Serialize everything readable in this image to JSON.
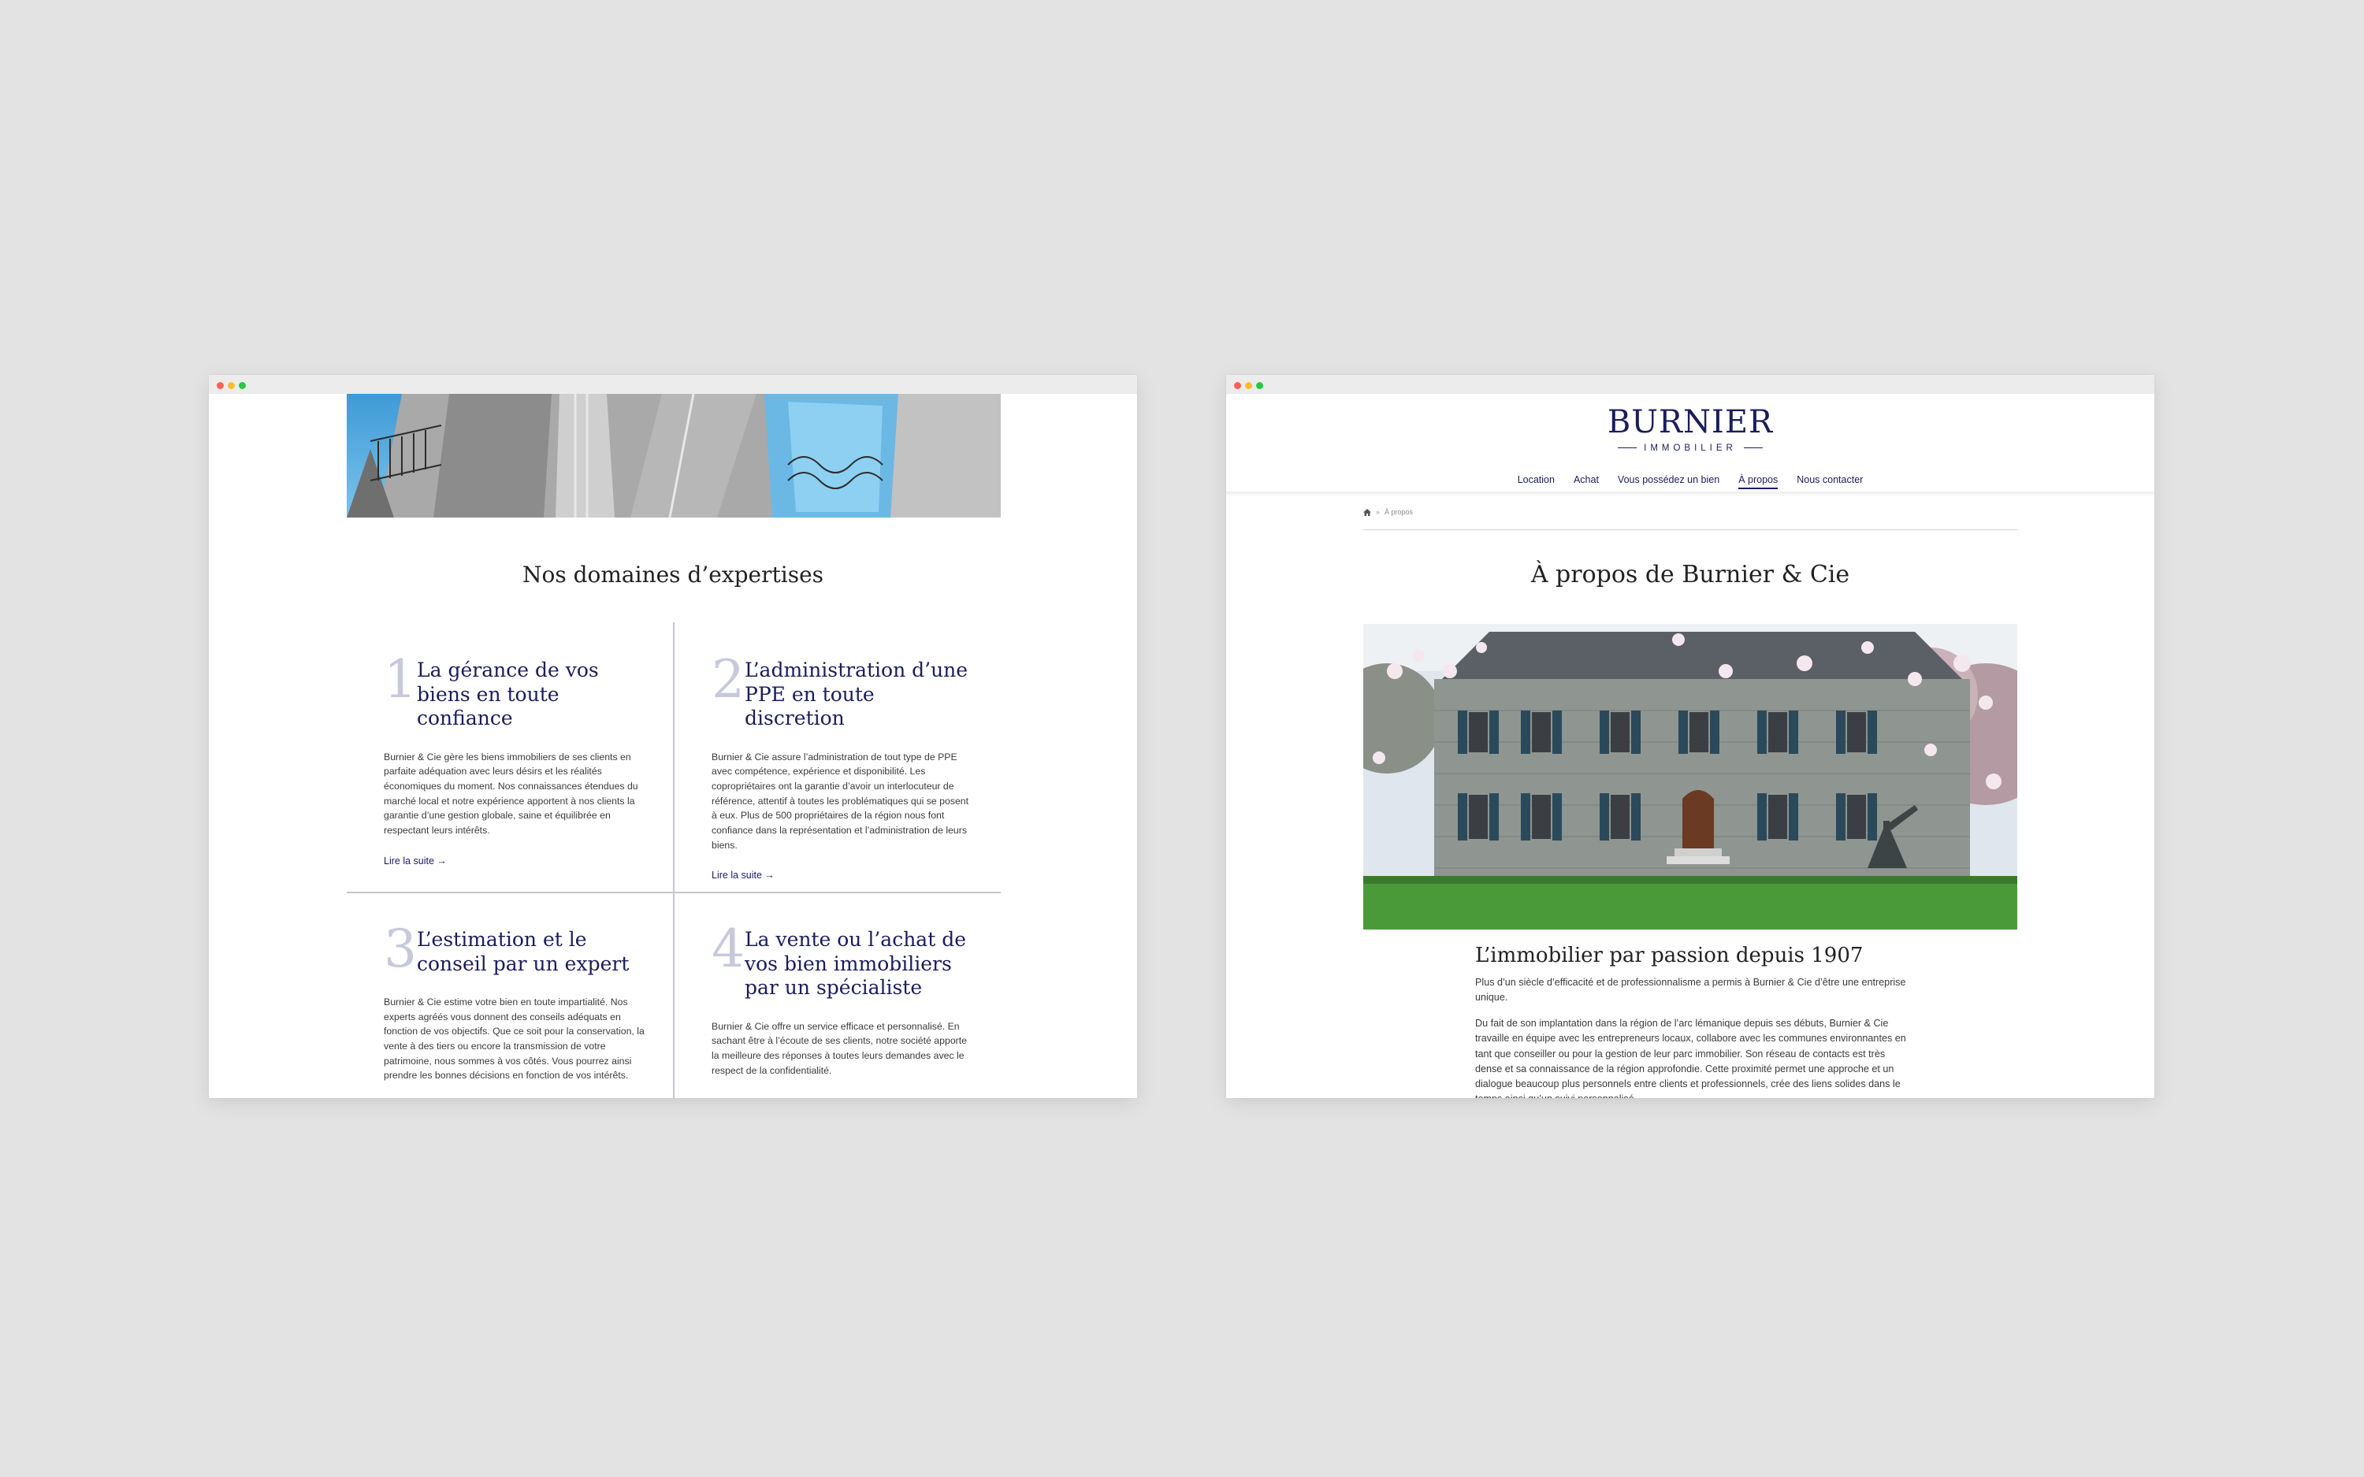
{
  "left_page": {
    "section_title": "Nos domaines d’expertises",
    "cards": [
      {
        "number": "1",
        "title": "La gérance de vos biens en toute confiance",
        "body": "Burnier & Cie gère les biens immobiliers de ses clients en parfaite adéquation avec leurs désirs et les réalités économiques du moment. Nos connaissances étendues du marché local et notre expérience apportent à nos clients la garantie d’une gestion globale, saine et équilibrée en respectant leurs intérêts.",
        "link": "Lire la suite →"
      },
      {
        "number": "2",
        "title": "L’administration d’une PPE en toute discretion",
        "body": "Burnier & Cie assure l’administration de tout type de PPE avec compétence, expérience et disponibilité. Les copropriétaires ont la garantie d’avoir un interlocuteur de référence, attentif à toutes les problématiques qui se posent à eux. Plus de 500 propriétaires de la région nous font confiance dans la représentation et l’administration de leurs biens.",
        "link": "Lire la suite →"
      },
      {
        "number": "3",
        "title": "L’estimation et le conseil par un expert",
        "body": "Burnier & Cie estime votre bien en toute impartialité. Nos experts agréés vous donnent des conseils adéquats en fonction de vos objectifs. Que ce soit pour la conservation, la vente à des tiers ou encore la transmission de votre patrimoine, nous sommes à vos côtés. Vous pourrez ainsi prendre les bonnes décisions en fonction de vos intérêts.",
        "link": ""
      },
      {
        "number": "4",
        "title": "La vente ou l’achat de vos bien immobiliers par un spécialiste",
        "body": "Burnier & Cie offre un service efficace et personnalisé. En sachant être à l’écoute de ses clients, notre société apporte la meilleure des réponses à toutes leurs demandes avec le respect de la confidentialité.",
        "link": ""
      }
    ]
  },
  "right_page": {
    "logo": {
      "main": "BURNIER",
      "sub": "IMMOBILIER"
    },
    "nav": [
      "Location",
      "Achat",
      "Vous possédez un bien",
      "À propos",
      "Nous contacter"
    ],
    "nav_active": "À propos",
    "breadcrumb": {
      "current": "À propos"
    },
    "page_title": "À propos de Burnier & Cie",
    "subtitle": "L’immobilier par passion depuis 1907",
    "paragraphs": [
      "Plus d’un siècle d’efficacité et de professionnalisme a permis à Burnier & Cie d’être une entreprise unique.",
      "Du fait de son implantation dans la région de l’arc lémanique depuis ses débuts, Burnier & Cie travaille en équipe avec les entrepreneurs locaux, collabore avec les communes environnantes en tant que conseiller ou pour la gestion de leur parc immobilier. Son réseau de contacts est très dense et sa connaissance de la région approfondie. Cette proximité permet une approche et un dialogue beaucoup plus personnels entre clients et professionnels, crée des liens solides dans le temps ainsi qu’un suivi personnalisé."
    ]
  },
  "colors": {
    "background": "#e3e3e3",
    "brand_navy": "#1a1d5c",
    "number_grey": "#c7c9db",
    "traffic_red": "#fe5f57",
    "traffic_yellow": "#febc2e",
    "traffic_green": "#28c840"
  },
  "icons": [
    "home-icon",
    "arrow-right-icon"
  ]
}
